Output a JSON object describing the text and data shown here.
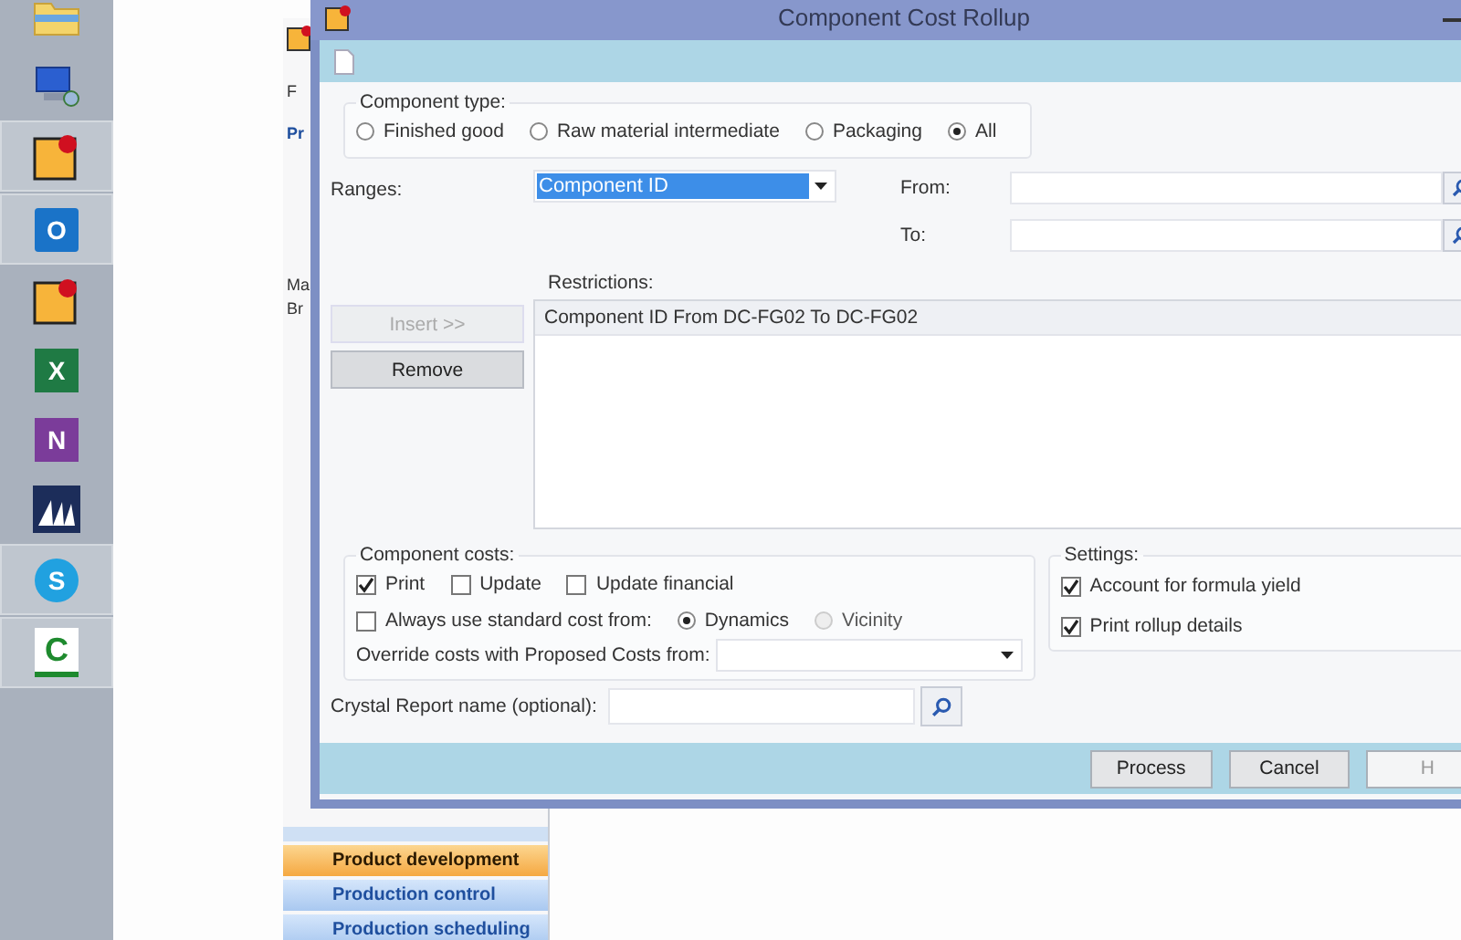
{
  "taskbar": {
    "items": [
      {
        "kind": "folder",
        "active": false
      },
      {
        "kind": "computer",
        "active": false
      },
      {
        "kind": "app",
        "active": true
      },
      {
        "kind": "mail",
        "glyph": "O",
        "active": true
      },
      {
        "kind": "app",
        "active": false
      },
      {
        "kind": "sheet",
        "glyph": "X",
        "active": false
      },
      {
        "kind": "note",
        "glyph": "N",
        "active": false
      },
      {
        "kind": "sails",
        "active": false
      },
      {
        "kind": "chat",
        "glyph": "S",
        "active": true
      },
      {
        "kind": "clogo",
        "glyph": "C",
        "active": true
      }
    ]
  },
  "back_window": {
    "fragments": [
      "F",
      "Pr",
      "Ma",
      "Br"
    ],
    "nav": [
      {
        "label": "Product development",
        "selected": true
      },
      {
        "label": "Production control",
        "selected": false
      },
      {
        "label": "Production scheduling",
        "selected": false
      }
    ]
  },
  "dialog": {
    "title": "Component Cost Rollup",
    "component_type": {
      "label": "Component type:",
      "options": [
        {
          "label": "Finished good",
          "selected": false
        },
        {
          "label": "Raw material intermediate",
          "selected": false
        },
        {
          "label": "Packaging",
          "selected": false
        },
        {
          "label": "All",
          "selected": true
        }
      ]
    },
    "ranges": {
      "label": "Ranges:",
      "value": "Component ID",
      "from_label": "From:",
      "to_label": "To:"
    },
    "restrictions": {
      "label": "Restrictions:",
      "items": [
        "Component ID From DC-FG02 To DC-FG02"
      ]
    },
    "side_buttons": [
      {
        "label": "Insert >>",
        "disabled": true
      },
      {
        "label": "Remove",
        "disabled": false
      }
    ],
    "component_costs": {
      "label": "Component costs:",
      "checks": [
        {
          "label": "Print",
          "checked": true
        },
        {
          "label": "Update",
          "checked": false
        },
        {
          "label": "Update financial",
          "checked": false
        }
      ],
      "always": {
        "label": "Always use standard cost from:",
        "checked": false
      },
      "sources": [
        {
          "label": "Dynamics",
          "selected": true,
          "disabled": false
        },
        {
          "label": "Vicinity",
          "selected": false,
          "disabled": true
        }
      ],
      "override_label": "Override costs with Proposed Costs from:"
    },
    "settings": {
      "label": "Settings:",
      "checks": [
        {
          "label": "Account for formula yield",
          "checked": true
        },
        {
          "label": "Print rollup details",
          "checked": true
        }
      ]
    },
    "crystal_label": "Crystal Report name (optional):",
    "buttons": [
      {
        "label": "Process"
      },
      {
        "label": "Cancel"
      },
      {
        "label": "H"
      }
    ]
  }
}
